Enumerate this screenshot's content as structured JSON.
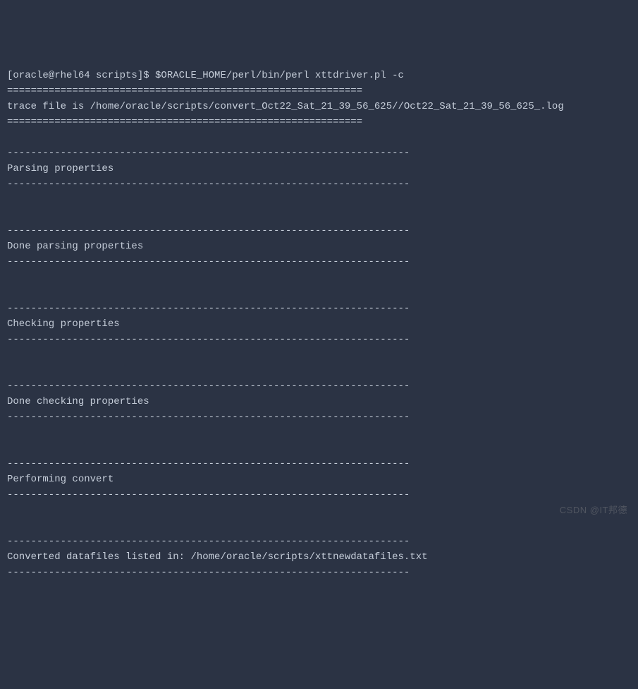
{
  "terminal": {
    "lines": [
      "[oracle@rhel64 scripts]$ $ORACLE_HOME/perl/bin/perl xttdriver.pl -c",
      "============================================================",
      "trace file is /home/oracle/scripts/convert_Oct22_Sat_21_39_56_625//Oct22_Sat_21_39_56_625_.log",
      "============================================================",
      "",
      "--------------------------------------------------------------------",
      "Parsing properties",
      "--------------------------------------------------------------------",
      "",
      "",
      "--------------------------------------------------------------------",
      "Done parsing properties",
      "--------------------------------------------------------------------",
      "",
      "",
      "--------------------------------------------------------------------",
      "Checking properties",
      "--------------------------------------------------------------------",
      "",
      "",
      "--------------------------------------------------------------------",
      "Done checking properties",
      "--------------------------------------------------------------------",
      "",
      "",
      "--------------------------------------------------------------------",
      "Performing convert",
      "--------------------------------------------------------------------",
      "",
      "",
      "--------------------------------------------------------------------",
      "Converted datafiles listed in: /home/oracle/scripts/xttnewdatafiles.txt",
      "--------------------------------------------------------------------"
    ]
  },
  "watermark": "CSDN @IT邦德"
}
